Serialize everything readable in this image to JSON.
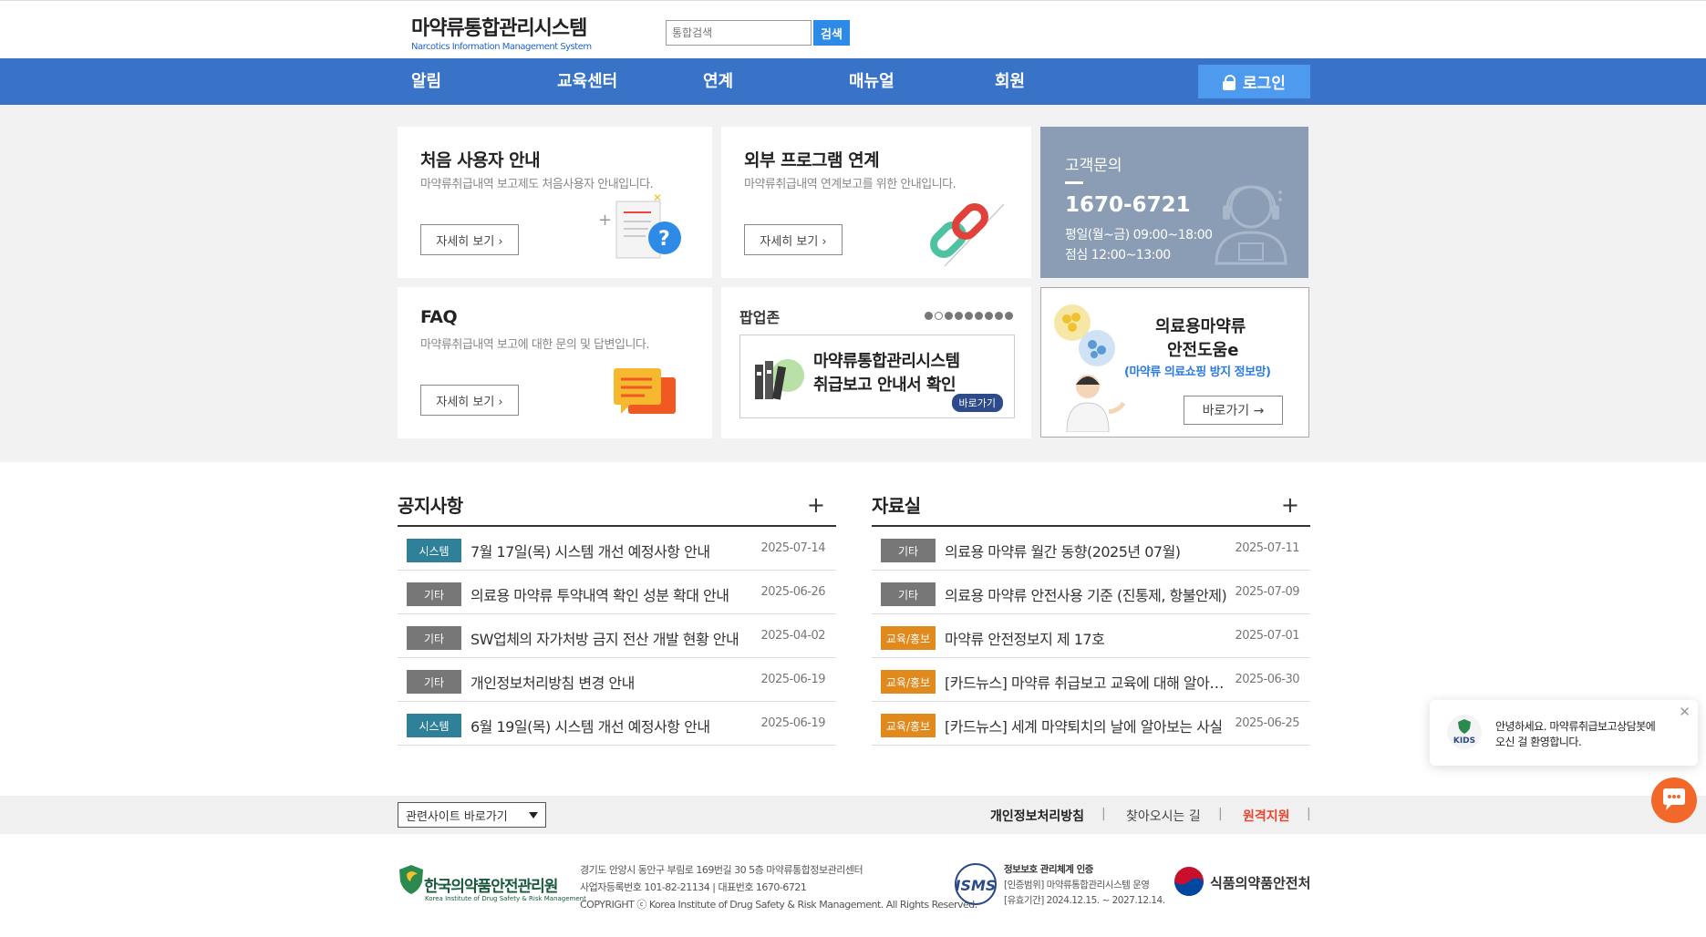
{
  "header": {
    "logo_kr": "마약류통합관리시스템",
    "logo_en": "Narcotics Information Management System",
    "search_placeholder": "통합검색",
    "search_button": "검색"
  },
  "nav": {
    "items": [
      "알림",
      "교육센터",
      "연계",
      "매뉴얼",
      "회원"
    ],
    "login": "로그인"
  },
  "cards": {
    "first_user": {
      "title": "처음 사용자 안내",
      "desc": "마약류취급내역 보고제도 처음사용자 안내입니다.",
      "more": "자세히 보기 ›"
    },
    "external": {
      "title": "외부 프로그램 연계",
      "desc": "마약류취급내역 연계보고를 위한 안내입니다.",
      "more": "자세히 보기 ›"
    },
    "faq": {
      "title": "FAQ",
      "desc": "마약류취급내역 보고에 대한 문의 및 답변입니다.",
      "more": "자세히 보기 ›"
    }
  },
  "contact": {
    "title": "고객문의",
    "phone": "1670-6721",
    "hours": "평일(월~금) 09:00~18:00",
    "lunch": "점심 12:00~13:00"
  },
  "popup_zone": {
    "title": "팝업존",
    "dots_total": 9,
    "active_dot": 1,
    "banner_line1": "마약류통합관리시스템",
    "banner_line2": "취급보고 안내서 확인",
    "banner_go": "바로가기"
  },
  "med_banner": {
    "line1": "의료용마약류",
    "line2": "안전도움e",
    "line3": "(마약류 의료쇼핑 방지 정보망)",
    "button": "바로가기 →"
  },
  "notice": {
    "title": "공지사항",
    "plus": "+",
    "rows": [
      {
        "badge": "시스템",
        "text": "7월 17일(목) 시스템 개선 예정사항 안내",
        "date": "2025-07-14"
      },
      {
        "badge": "기타",
        "text": "의료용 마약류 투약내역 확인 성분 확대 안내",
        "date": "2025-06-26"
      },
      {
        "badge": "기타",
        "text": "SW업체의 자가처방 금지 전산 개발 현황 안내",
        "date": "2025-04-02"
      },
      {
        "badge": "기타",
        "text": "개인정보처리방침 변경 안내",
        "date": "2025-06-19"
      },
      {
        "badge": "시스템",
        "text": "6월 19일(목) 시스템 개선 예정사항 안내",
        "date": "2025-06-19"
      }
    ]
  },
  "archive": {
    "title": "자료실",
    "plus": "+",
    "rows": [
      {
        "badge": "기타",
        "text": "의료용 마약류 월간 동향(2025년 07월)",
        "date": "2025-07-11"
      },
      {
        "badge": "기타",
        "text": "의료용 마약류 안전사용 기준 (진통제, 항불안제)",
        "date": "2025-07-09"
      },
      {
        "badge": "교육/홍보",
        "text": "마약류 안전정보지 제 17호",
        "date": "2025-07-01"
      },
      {
        "badge": "교육/홍보",
        "text": "[카드뉴스] 마약류 취급보고 교육에 대해 알아보세요",
        "date": "2025-06-30"
      },
      {
        "badge": "교육/홍보",
        "text": "[카드뉴스] 세계 마약퇴치의 날에 알아보는 사실",
        "date": "2025-06-25"
      }
    ]
  },
  "colors": {
    "nav": "#3873c8",
    "badge_system": "#2f8099",
    "badge_etc": "#777777",
    "badge_edu": "#e08a1e"
  },
  "footer": {
    "site_select": "관련사이트 바로가기",
    "links": [
      "개인정보처리방침",
      "찾아오시는 길",
      "원격지원"
    ],
    "sep": "|",
    "kids_kr": "한국의약품안전관리원",
    "kids_en": "Korea Institute of Drug Safety & Risk Management",
    "addr1": "경기도 안양시 동안구 부림로 169번길 30 5층 마약류통합정보관리센터",
    "addr2": "사업자등록번호 101-82-21134 | 대표번호 1670-6721",
    "addr3": "COPYRIGHT ⓒ Korea Institute of Drug Safety & Risk Management. All Rights Reserved.",
    "isms_logo": "ISMS",
    "isms1": "정보보호 관리체계 인증",
    "isms2": "[인증범위] 마약류통합관리시스템 운영",
    "isms3": "[유효기간] 2024.12.15. ~ 2027.12.14.",
    "mfds": "식품의약품안전처"
  },
  "chat": {
    "line1": "안녕하세요. 마약류취급보고상담봇에",
    "line2": "오신 걸 환영합니다.",
    "logo": "KIDS",
    "close": "✕"
  }
}
